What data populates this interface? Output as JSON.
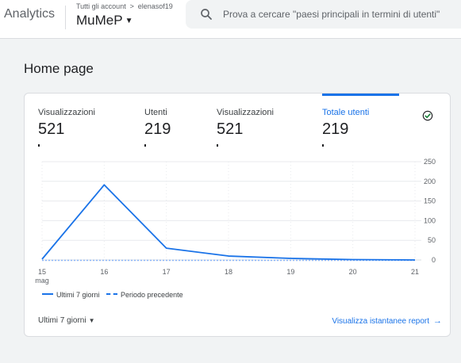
{
  "header": {
    "app_name": "Analytics",
    "breadcrumb_account": "Tutti gli account",
    "breadcrumb_separator": ">",
    "breadcrumb_user": "elenasof19",
    "property_name": "MuMeP",
    "search_placeholder": "Prova a cercare \"paesi principali in termini di utenti\""
  },
  "page": {
    "title": "Home page"
  },
  "card": {
    "metrics": [
      {
        "label": "Visualizzazioni",
        "value": "521"
      },
      {
        "label": "Utenti",
        "value": "219"
      },
      {
        "label": "Visualizzazioni",
        "value": "521"
      },
      {
        "label": "Totale utenti",
        "value": "219",
        "active": true
      }
    ],
    "legend": {
      "current": "Ultimi 7 giorni",
      "previous": "Periodo precedente"
    },
    "footer": {
      "range": "Ultimi 7 giorni",
      "link": "Visualizza istantanee report"
    }
  },
  "colors": {
    "accent": "#1a73e8",
    "line_dark": "#1c3b6e",
    "check": "#188038"
  },
  "chart_data": {
    "type": "line",
    "x": [
      "15",
      "16",
      "17",
      "18",
      "19",
      "20",
      "21"
    ],
    "x_sublabel": "mag",
    "y_ticks": [
      0,
      50,
      100,
      150,
      200,
      250
    ],
    "ylim": [
      0,
      250
    ],
    "y_axis_position": "right",
    "grid": true,
    "legend_position": "bottom-left",
    "series": [
      {
        "name": "Ultimi 7 giorni",
        "style": "solid",
        "values": [
          2,
          191,
          30,
          10,
          4,
          1,
          0
        ]
      },
      {
        "name": "Periodo precedente",
        "style": "dashed",
        "values": [
          0,
          0,
          0,
          0,
          0,
          0,
          0
        ]
      }
    ]
  }
}
